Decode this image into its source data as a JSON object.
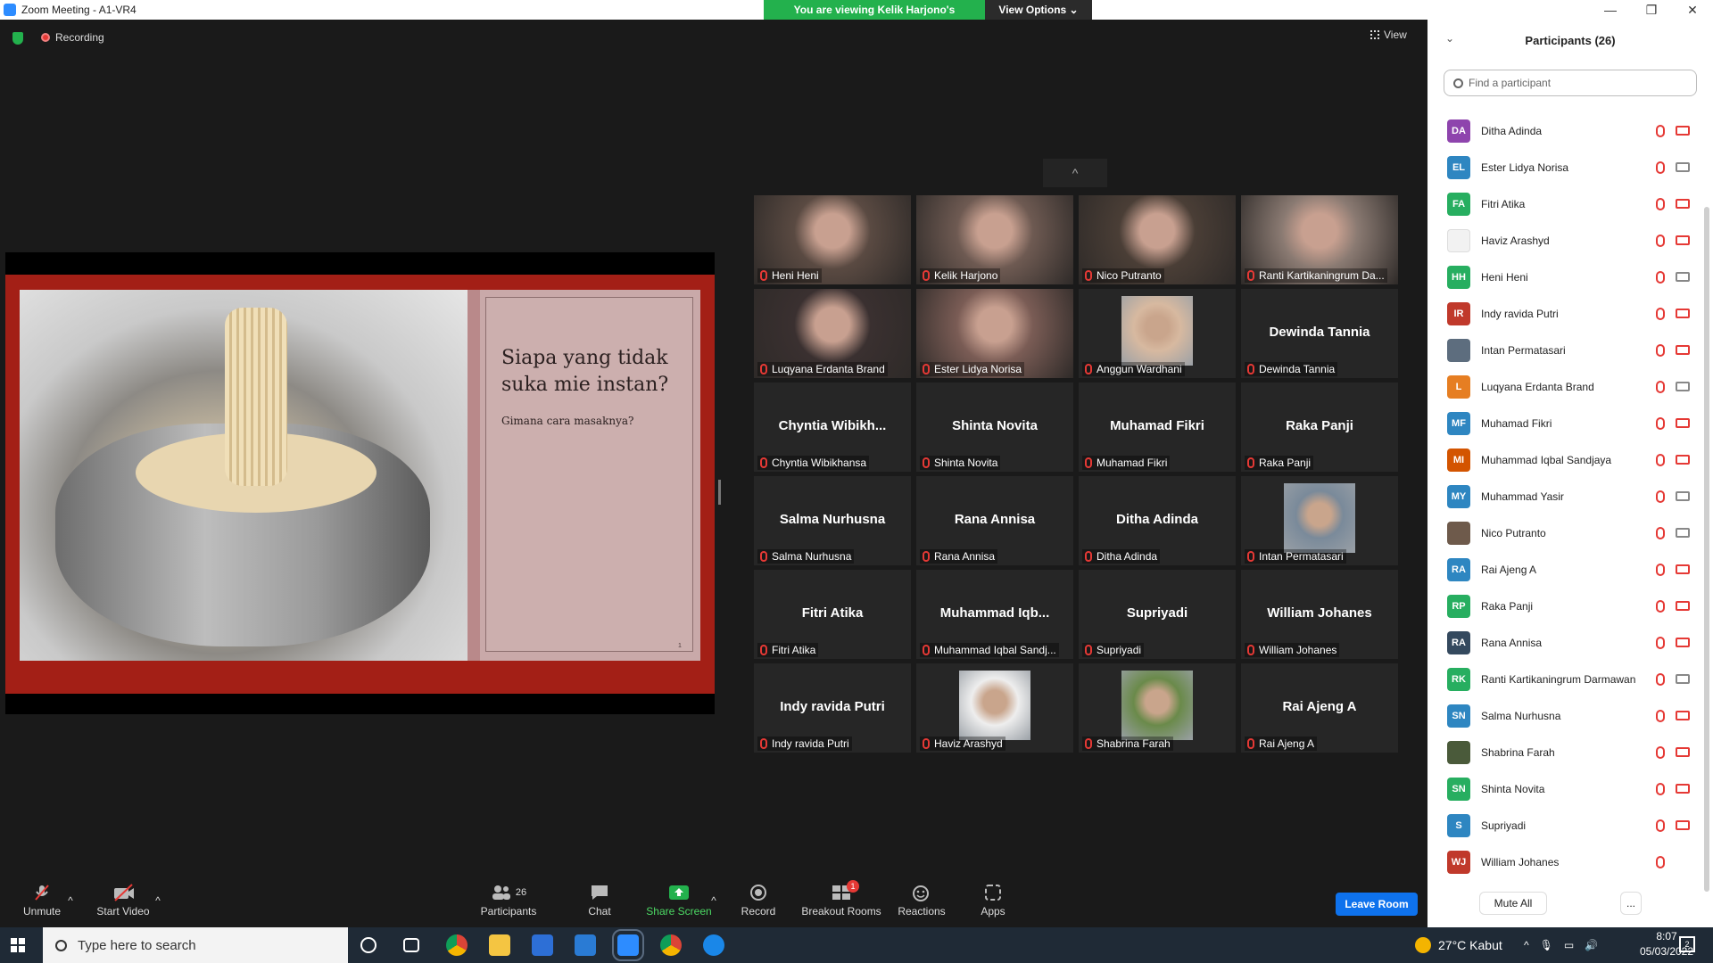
{
  "window": {
    "title": "Zoom Meeting - A1-VR4",
    "viewing_banner": "You are viewing Kelik Harjono's screen",
    "view_options": "View Options ⌄",
    "controls": [
      "—",
      "❐",
      "✕"
    ]
  },
  "meeting": {
    "recording_label": "Recording",
    "view_label": "View",
    "collapse_icon": "^"
  },
  "slide": {
    "heading": "Siapa yang tidak suka mie instan?",
    "subtitle": "Gimana cara masaknya?",
    "page_number": "1"
  },
  "gallery": [
    {
      "display": "",
      "label": "Heni Heni",
      "video": true
    },
    {
      "display": "",
      "label": "Kelik Harjono",
      "video": true,
      "active": true
    },
    {
      "display": "",
      "label": "Nico Putranto",
      "video": true
    },
    {
      "display": "",
      "label": "Ranti Kartikaningrum Da...",
      "video": true
    },
    {
      "display": "",
      "label": "Luqyana Erdanta Brand",
      "video": true
    },
    {
      "display": "",
      "label": "Ester Lidya Norisa",
      "video": true
    },
    {
      "display": "",
      "label": "Anggun Wardhani",
      "thumb": true
    },
    {
      "display": "Dewinda Tannia",
      "label": "Dewinda Tannia"
    },
    {
      "display": "Chyntia  Wibikh...",
      "label": "Chyntia Wibikhansa"
    },
    {
      "display": "Shinta Novita",
      "label": "Shinta Novita"
    },
    {
      "display": "Muhamad Fikri",
      "label": "Muhamad Fikri"
    },
    {
      "display": "Raka Panji",
      "label": "Raka Panji"
    },
    {
      "display": "Salma Nurhusna",
      "label": "Salma Nurhusna"
    },
    {
      "display": "Rana Annisa",
      "label": "Rana Annisa"
    },
    {
      "display": "Ditha Adinda",
      "label": "Ditha Adinda"
    },
    {
      "display": "",
      "label": "Intan Permatasari",
      "thumb": true
    },
    {
      "display": "Fitri Atika",
      "label": "Fitri Atika"
    },
    {
      "display": "Muhammad  Iqb...",
      "label": "Muhammad Iqbal Sandj..."
    },
    {
      "display": "Supriyadi",
      "label": "Supriyadi"
    },
    {
      "display": "William Johanes",
      "label": "William Johanes"
    },
    {
      "display": "Indy ravida Putri",
      "label": "Indy ravida Putri"
    },
    {
      "display": "",
      "label": "Haviz Arashyd",
      "thumb": true
    },
    {
      "display": "",
      "label": "Shabrina Farah",
      "thumb": true
    },
    {
      "display": "Rai Ajeng A",
      "label": "Rai Ajeng A"
    }
  ],
  "participants_panel": {
    "title": "Participants (26)",
    "search_placeholder": "Find a participant",
    "mute_all": "Mute All",
    "more": "...",
    "list": [
      {
        "initials": "DA",
        "name": "Ditha Adinda",
        "color": "#8e44ad",
        "cam_on": false
      },
      {
        "initials": "EL",
        "name": "Ester Lidya Norisa",
        "color": "#2e86c1",
        "cam_on": true
      },
      {
        "initials": "FA",
        "name": "Fitri Atika",
        "color": "#27ae60",
        "cam_on": false
      },
      {
        "initials": "",
        "name": "Haviz Arashyd",
        "color": "#f2f2f2",
        "cam_on": false
      },
      {
        "initials": "HH",
        "name": "Heni Heni",
        "color": "#27ae60",
        "cam_on": true
      },
      {
        "initials": "IR",
        "name": "Indy ravida Putri",
        "color": "#c0392b",
        "cam_on": false
      },
      {
        "initials": "",
        "name": "Intan Permatasari",
        "color": "#5d6d7e",
        "cam_on": false
      },
      {
        "initials": "L",
        "name": "Luqyana Erdanta Brand",
        "color": "#e67e22",
        "cam_on": true
      },
      {
        "initials": "MF",
        "name": "Muhamad Fikri",
        "color": "#2e86c1",
        "cam_on": false
      },
      {
        "initials": "MI",
        "name": "Muhammad Iqbal Sandjaya",
        "color": "#d35400",
        "cam_on": false
      },
      {
        "initials": "MY",
        "name": "Muhammad Yasir",
        "color": "#2e86c1",
        "cam_on": true
      },
      {
        "initials": "",
        "name": "Nico Putranto",
        "color": "#6e5a4b",
        "cam_on": true
      },
      {
        "initials": "RA",
        "name": "Rai Ajeng A",
        "color": "#2e86c1",
        "cam_on": false
      },
      {
        "initials": "RP",
        "name": "Raka Panji",
        "color": "#27ae60",
        "cam_on": false
      },
      {
        "initials": "RA",
        "name": "Rana Annisa",
        "color": "#34495e",
        "cam_on": false
      },
      {
        "initials": "RK",
        "name": "Ranti Kartikaningrum Darmawan",
        "color": "#27ae60",
        "cam_on": true
      },
      {
        "initials": "SN",
        "name": "Salma Nurhusna",
        "color": "#2e86c1",
        "cam_on": false
      },
      {
        "initials": "",
        "name": "Shabrina Farah",
        "color": "#4a5a3a",
        "cam_on": false
      },
      {
        "initials": "SN",
        "name": "Shinta Novita",
        "color": "#27ae60",
        "cam_on": false
      },
      {
        "initials": "S",
        "name": "Supriyadi",
        "color": "#2e86c1",
        "cam_on": false
      },
      {
        "initials": "WJ",
        "name": "William Johanes",
        "color": "#c0392b",
        "cam_on": null
      }
    ]
  },
  "toolbar": {
    "unmute": "Unmute",
    "start_video": "Start Video",
    "participants": "Participants",
    "participants_count": "26",
    "chat": "Chat",
    "share_screen": "Share Screen",
    "record": "Record",
    "breakout_rooms": "Breakout Rooms",
    "breakout_badge": "1",
    "reactions": "Reactions",
    "apps": "Apps",
    "leave_room": "Leave Room"
  },
  "taskbar": {
    "search_placeholder": "Type here to search",
    "weather": "27°C  Kabut",
    "time": "8:07",
    "date": "05/03/2022",
    "notification_count": "2"
  }
}
